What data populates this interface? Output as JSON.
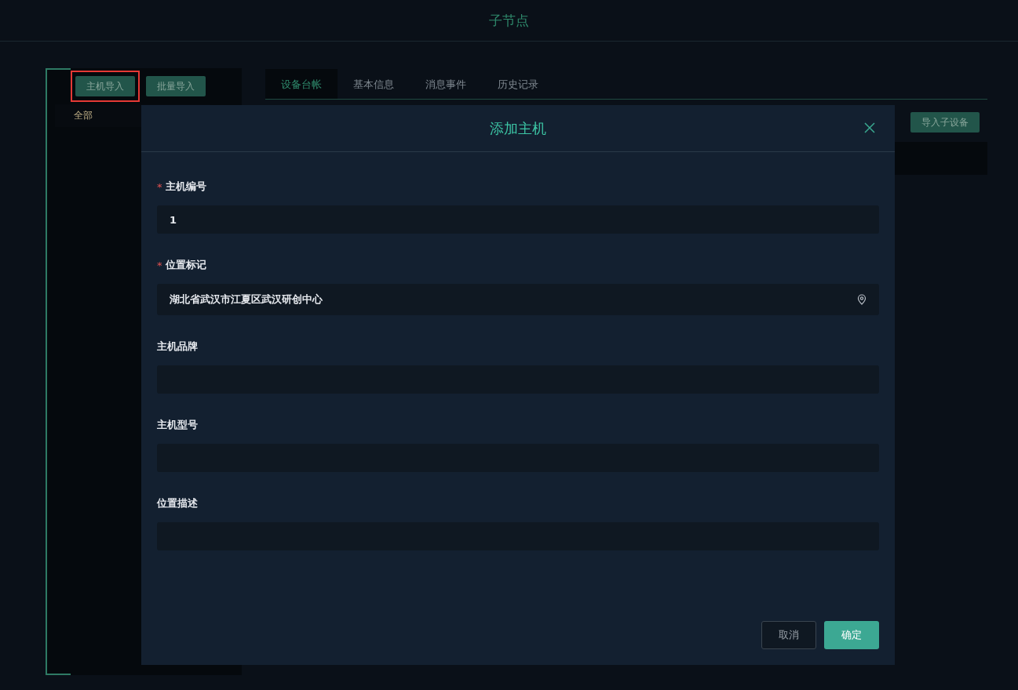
{
  "header": {
    "title": "子节点"
  },
  "sidebar": {
    "buttons": [
      {
        "label": "主机导入",
        "highlighted": true
      },
      {
        "label": "批量导入",
        "highlighted": false
      }
    ],
    "items": [
      {
        "label": "全部",
        "selected": true
      }
    ]
  },
  "tabs": [
    {
      "label": "设备台帐",
      "selected": true
    },
    {
      "label": "基本信息",
      "selected": false
    },
    {
      "label": "消息事件",
      "selected": false
    },
    {
      "label": "历史记录",
      "selected": false
    }
  ],
  "toolbar": {
    "buttons": [
      "导入子设备"
    ]
  },
  "dialog": {
    "title": "添加主机",
    "fields": [
      {
        "label": "主机编号",
        "required_mark": "*",
        "value": "1",
        "kind": "text"
      },
      {
        "label": "位置标记",
        "required_mark": "*",
        "value": "湖北省武汉市江夏区武汉研创中心",
        "kind": "location"
      },
      {
        "label": "主机品牌",
        "kind": "text"
      },
      {
        "label": "主机型号",
        "kind": "text"
      },
      {
        "label": "位置描述",
        "kind": "text"
      }
    ],
    "buttons": [
      {
        "label": "取消",
        "kind": "secondary"
      },
      {
        "label": "确定",
        "kind": "primary"
      }
    ]
  }
}
